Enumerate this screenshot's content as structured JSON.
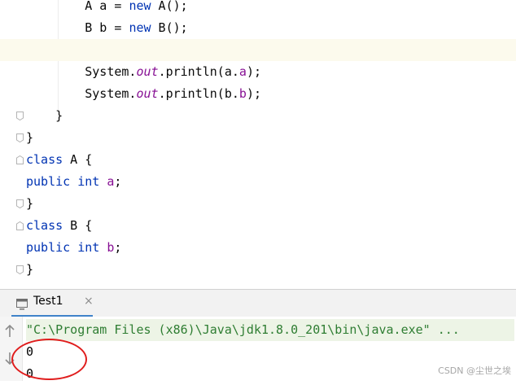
{
  "editor": {
    "lines": [
      {
        "parts": [
          {
            "t": "        A a = "
          },
          {
            "t": "new",
            "c": "kw"
          },
          {
            "t": " A();"
          }
        ]
      },
      {
        "parts": [
          {
            "t": "        B b = "
          },
          {
            "t": "new",
            "c": "kw"
          },
          {
            "t": " B();"
          }
        ]
      },
      {
        "parts": [
          {
            "t": ""
          }
        ],
        "highlight": true
      },
      {
        "parts": [
          {
            "t": "        System."
          },
          {
            "t": "out",
            "c": "st"
          },
          {
            "t": ".println(a."
          },
          {
            "t": "a",
            "c": "fld"
          },
          {
            "t": ");"
          }
        ]
      },
      {
        "parts": [
          {
            "t": "        System."
          },
          {
            "t": "out",
            "c": "st"
          },
          {
            "t": ".println(b."
          },
          {
            "t": "b",
            "c": "fld"
          },
          {
            "t": ");"
          }
        ]
      },
      {
        "parts": [
          {
            "t": "    }"
          }
        ],
        "fold": "end"
      },
      {
        "parts": [
          {
            "t": "}"
          }
        ],
        "fold": "end"
      },
      {
        "parts": [
          {
            "t": "class",
            "c": "kw"
          },
          {
            "t": " A {"
          }
        ],
        "fold": "start"
      },
      {
        "parts": [
          {
            "t": "public",
            "c": "kw"
          },
          {
            "t": " "
          },
          {
            "t": "int",
            "c": "kw"
          },
          {
            "t": " "
          },
          {
            "t": "a",
            "c": "fld"
          },
          {
            "t": ";"
          }
        ]
      },
      {
        "parts": [
          {
            "t": "}"
          }
        ],
        "fold": "end"
      },
      {
        "parts": [
          {
            "t": "class",
            "c": "kw"
          },
          {
            "t": " B {"
          }
        ],
        "fold": "start"
      },
      {
        "parts": [
          {
            "t": "public",
            "c": "kw"
          },
          {
            "t": " "
          },
          {
            "t": "int",
            "c": "kw"
          },
          {
            "t": " "
          },
          {
            "t": "b",
            "c": "fld"
          },
          {
            "t": ";"
          }
        ]
      },
      {
        "parts": [
          {
            "t": "}"
          }
        ],
        "fold": "end"
      }
    ]
  },
  "run_panel": {
    "tab_label": "Test1",
    "tab_icon": "run-config-icon",
    "close_icon": "close-icon",
    "close_glyph": "×"
  },
  "console": {
    "lines": [
      "\"C:\\Program Files (x86)\\Java\\jdk1.8.0_201\\bin\\java.exe\" ...",
      "0",
      "0"
    ],
    "gutter_icons": [
      "arrow-up-icon",
      "arrow-down-icon"
    ]
  },
  "watermark": "CSDN @尘世之埃",
  "colors": {
    "keyword": "#0033b3",
    "field": "#871094",
    "annotation": "#e01d1d",
    "tab_accent": "#4083c9"
  }
}
